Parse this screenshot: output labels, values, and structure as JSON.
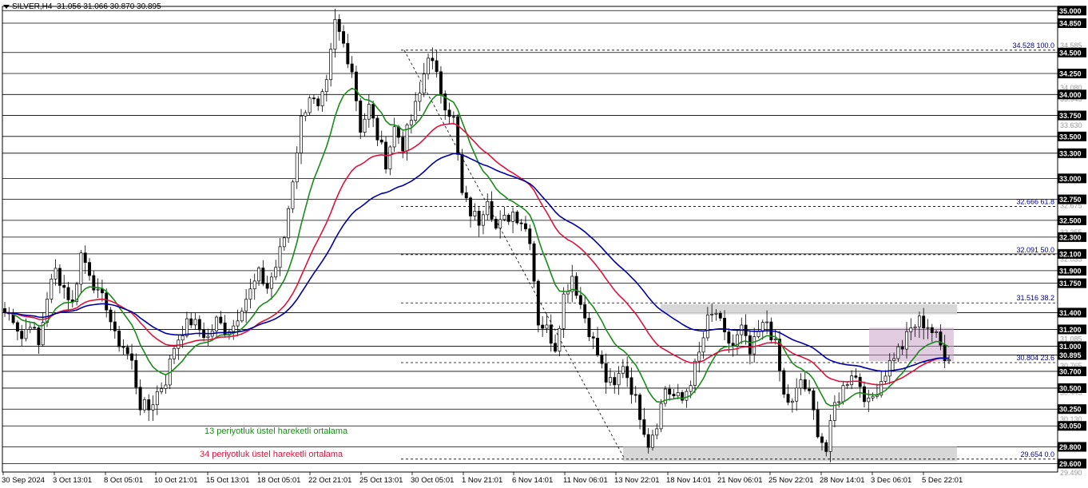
{
  "header": {
    "symbol": "SILVER,H4",
    "ohlc": "31.056 31.066 30.870 30.895"
  },
  "icons": {
    "menu": "triangle-down-icon"
  },
  "colors": {
    "candle": "#000000",
    "ema13": "#1a8a1a",
    "ema34": "#dc143c",
    "ema_blue": "#0000a0",
    "zone": "#d3d3d3",
    "box": "#c8a2c8",
    "level_line": "#000000",
    "fib_line": "#000000",
    "price_tag_bg": "#000000",
    "price_tag_text": "#ffffff"
  },
  "annotations": {
    "ema13_label": "13 periyotluk üstel hareketli ortalama",
    "ema34_label": "34 periyotluk üstel hareketli ortalama"
  },
  "chart_data": {
    "type": "candlestick",
    "symbol": "SILVER",
    "timeframe": "H4",
    "ylim": [
      29.5,
      35.05
    ],
    "time_labels": [
      "30 Sep 2024",
      "3 Oct 13:01",
      "8 Oct 05:01",
      "10 Oct 21:01",
      "15 Oct 13:01",
      "18 Oct 05:01",
      "22 Oct 21:01",
      "25 Oct 13:01",
      "30 Oct 05:01",
      "1 Nov 21:01",
      "6 Nov 14:01",
      "11 Nov 06:01",
      "13 Nov 22:01",
      "18 Nov 14:01",
      "21 Nov 06:01",
      "25 Nov 22:01",
      "28 Nov 14:01",
      "3 Dec 06:01",
      "5 Dec 22:01"
    ],
    "levels": [
      35.0,
      34.85,
      34.5,
      34.25,
      34.0,
      33.75,
      33.5,
      33.3,
      33.0,
      32.75,
      32.5,
      32.3,
      32.1,
      31.9,
      31.75,
      31.4,
      31.2,
      31.0,
      30.895,
      30.7,
      30.5,
      30.25,
      30.05,
      29.8,
      29.6
    ],
    "price_tags": [
      "35.000",
      "34.850",
      "34.500",
      "34.250",
      "34.000",
      "33.750",
      "33.500",
      "33.300",
      "33.000",
      "32.750",
      "32.500",
      "32.300",
      "32.100",
      "31.900",
      "31.750",
      "31.400",
      "31.200",
      "31.000",
      "30.895",
      "30.700",
      "30.500",
      "30.250",
      "30.050",
      "29.800",
      "29.600"
    ],
    "faded_ticks": [
      "34.080",
      "34.585",
      "33.945",
      "33.630",
      "32.675",
      "32.355",
      "32.035",
      "31.085",
      "30.765",
      "30.445",
      "30.130",
      "29.490"
    ],
    "fib_levels": [
      {
        "label": "34.528 100.0",
        "value": 34.528
      },
      {
        "label": "32.666 61.8",
        "value": 32.666
      },
      {
        "label": "32.091 50.0",
        "value": 32.091
      },
      {
        "label": "31.516 38.2",
        "value": 31.516
      },
      {
        "label": "30.804 23.6",
        "value": 30.804
      },
      {
        "label": "29.654 0.0",
        "value": 29.654
      }
    ],
    "zones": [
      {
        "name": "resistance-zone",
        "from": 31.38,
        "to": 31.5
      },
      {
        "name": "support-zone",
        "from": 29.63,
        "to": 29.8
      }
    ],
    "consolidation_box": {
      "from": 30.82,
      "to": 31.22
    },
    "waypoints": [
      [
        0,
        31.4
      ],
      [
        2,
        31.35
      ],
      [
        4,
        31.1
      ],
      [
        6,
        31.3
      ],
      [
        8,
        31.0
      ],
      [
        10,
        31.6
      ],
      [
        12,
        31.9
      ],
      [
        14,
        31.7
      ],
      [
        16,
        31.5
      ],
      [
        18,
        32.1
      ],
      [
        20,
        31.9
      ],
      [
        22,
        31.6
      ],
      [
        24,
        31.5
      ],
      [
        26,
        31.1
      ],
      [
        28,
        31.0
      ],
      [
        30,
        30.8
      ],
      [
        32,
        30.3
      ],
      [
        34,
        30.25
      ],
      [
        36,
        30.45
      ],
      [
        38,
        30.6
      ],
      [
        40,
        31.0
      ],
      [
        42,
        31.2
      ],
      [
        44,
        31.3
      ],
      [
        46,
        31.2
      ],
      [
        48,
        31.1
      ],
      [
        50,
        31.3
      ],
      [
        52,
        31.2
      ],
      [
        54,
        31.25
      ],
      [
        56,
        31.5
      ],
      [
        58,
        31.65
      ],
      [
        60,
        31.85
      ],
      [
        62,
        31.7
      ],
      [
        64,
        31.95
      ],
      [
        66,
        32.3
      ],
      [
        68,
        33.0
      ],
      [
        70,
        33.7
      ],
      [
        72,
        34.0
      ],
      [
        74,
        33.8
      ],
      [
        76,
        34.1
      ],
      [
        78,
        34.85
      ],
      [
        80,
        34.6
      ],
      [
        82,
        34.3
      ],
      [
        84,
        33.6
      ],
      [
        86,
        33.85
      ],
      [
        88,
        33.5
      ],
      [
        90,
        33.2
      ],
      [
        92,
        33.6
      ],
      [
        94,
        33.4
      ],
      [
        96,
        33.7
      ],
      [
        98,
        34.0
      ],
      [
        100,
        34.5
      ],
      [
        102,
        34.2
      ],
      [
        104,
        33.9
      ],
      [
        106,
        33.7
      ],
      [
        108,
        32.8
      ],
      [
        110,
        32.6
      ],
      [
        112,
        32.5
      ],
      [
        114,
        32.8
      ],
      [
        116,
        32.4
      ],
      [
        118,
        32.5
      ],
      [
        120,
        32.6
      ],
      [
        122,
        32.5
      ],
      [
        124,
        32.3
      ],
      [
        126,
        31.3
      ],
      [
        128,
        31.2
      ],
      [
        130,
        31.0
      ],
      [
        132,
        31.6
      ],
      [
        134,
        31.85
      ],
      [
        136,
        31.5
      ],
      [
        138,
        31.2
      ],
      [
        140,
        30.9
      ],
      [
        142,
        30.6
      ],
      [
        144,
        30.5
      ],
      [
        146,
        30.8
      ],
      [
        148,
        30.5
      ],
      [
        150,
        30.2
      ],
      [
        152,
        29.85
      ],
      [
        154,
        30.1
      ],
      [
        156,
        30.5
      ],
      [
        158,
        30.4
      ],
      [
        160,
        30.35
      ],
      [
        162,
        30.6
      ],
      [
        164,
        30.9
      ],
      [
        166,
        31.3
      ],
      [
        168,
        31.4
      ],
      [
        170,
        31.1
      ],
      [
        172,
        31.0
      ],
      [
        174,
        31.2
      ],
      [
        176,
        30.9
      ],
      [
        178,
        31.15
      ],
      [
        180,
        31.3
      ],
      [
        182,
        31.0
      ],
      [
        184,
        30.4
      ],
      [
        186,
        30.3
      ],
      [
        188,
        30.6
      ],
      [
        190,
        30.4
      ],
      [
        192,
        30.0
      ],
      [
        194,
        29.75
      ],
      [
        196,
        30.3
      ],
      [
        198,
        30.5
      ],
      [
        200,
        30.7
      ],
      [
        202,
        30.55
      ],
      [
        204,
        30.3
      ],
      [
        206,
        30.5
      ],
      [
        208,
        30.7
      ],
      [
        210,
        30.9
      ],
      [
        212,
        31.0
      ],
      [
        214,
        31.2
      ],
      [
        216,
        31.3
      ],
      [
        218,
        31.25
      ],
      [
        220,
        31.1
      ],
      [
        222,
        30.9
      ]
    ]
  }
}
